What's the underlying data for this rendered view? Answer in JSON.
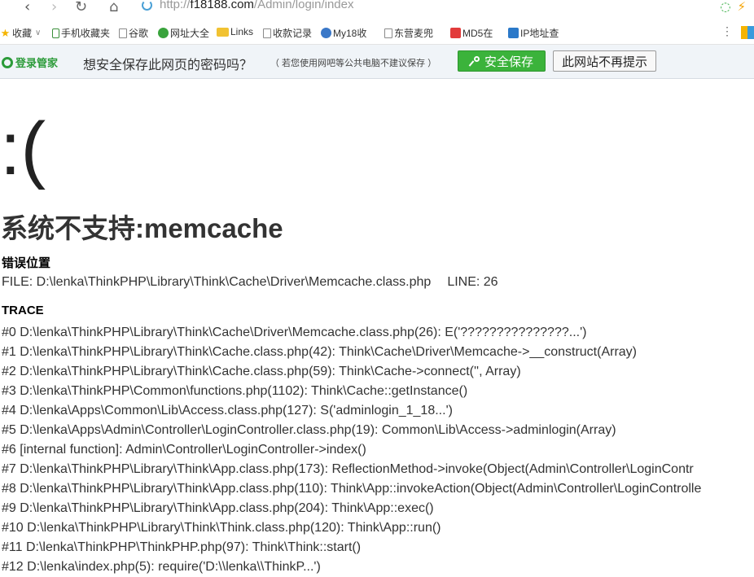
{
  "browser": {
    "url_prefix": "http://",
    "url_host": "f18188.com",
    "url_path": "/Admin/login/index"
  },
  "bookmarks": [
    {
      "label": "收藏",
      "icon": "star-icon"
    },
    {
      "label": "手机收藏夹",
      "icon": "phone-icon"
    },
    {
      "label": "谷歌",
      "icon": "page-icon"
    },
    {
      "label": "网址大全",
      "icon": "green-globe-icon"
    },
    {
      "label": "Links",
      "icon": "folder-icon"
    },
    {
      "label": "收款记录",
      "icon": "page-icon"
    },
    {
      "label": "My18收",
      "icon": "globe-icon"
    },
    {
      "label": "东营麦兜",
      "icon": "page-icon"
    },
    {
      "label": "MD5在",
      "icon": "red-square-icon"
    },
    {
      "label": "IP地址查",
      "icon": "ip-icon"
    }
  ],
  "password_bar": {
    "logo_text": "登录管家",
    "message": "想安全保存此网页的密码吗？",
    "note": "（ 若您使用网吧等公共电脑不建议保存 ）",
    "save_label": "安全保存",
    "never_label": "此网站不再提示"
  },
  "error": {
    "face": ":(",
    "title": "系统不支持:memcache",
    "location_heading": "错误位置",
    "file": "FILE: D:\\lenka\\ThinkPHP\\Library\\Think\\Cache\\Driver\\Memcache.class.php",
    "line": "LINE: 26",
    "trace_heading": "TRACE",
    "trace": [
      "#0 D:\\lenka\\ThinkPHP\\Library\\Think\\Cache\\Driver\\Memcache.class.php(26): E('???????????????...')",
      "#1 D:\\lenka\\ThinkPHP\\Library\\Think\\Cache.class.php(42): Think\\Cache\\Driver\\Memcache->__construct(Array)",
      "#2 D:\\lenka\\ThinkPHP\\Library\\Think\\Cache.class.php(59): Think\\Cache->connect('', Array)",
      "#3 D:\\lenka\\ThinkPHP\\Common\\functions.php(1102): Think\\Cache::getInstance()",
      "#4 D:\\lenka\\Apps\\Common\\Lib\\Access.class.php(127): S('adminlogin_1_18...')",
      "#5 D:\\lenka\\Apps\\Admin\\Controller\\LoginController.class.php(19): Common\\Lib\\Access->adminlogin(Array)",
      "#6 [internal function]: Admin\\Controller\\LoginController->index()",
      "#7 D:\\lenka\\ThinkPHP\\Library\\Think\\App.class.php(173): ReflectionMethod->invoke(Object(Admin\\Controller\\LoginContr",
      "#8 D:\\lenka\\ThinkPHP\\Library\\Think\\App.class.php(110): Think\\App::invokeAction(Object(Admin\\Controller\\LoginControlle",
      "#9 D:\\lenka\\ThinkPHP\\Library\\Think\\App.class.php(204): Think\\App::exec()",
      "#10 D:\\lenka\\ThinkPHP\\Library\\Think\\Think.class.php(120): Think\\App::run()",
      "#11 D:\\lenka\\ThinkPHP\\ThinkPHP.php(97): Think\\Think::start()",
      "#12 D:\\lenka\\index.php(5): require('D:\\\\lenka\\\\ThinkP...')"
    ]
  }
}
